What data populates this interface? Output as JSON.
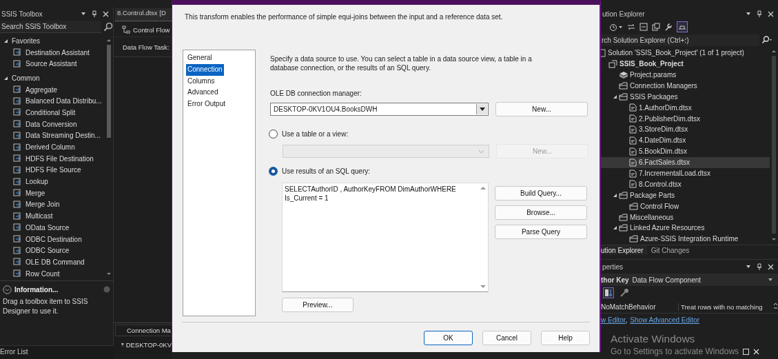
{
  "toolbox": {
    "title": "SSIS Toolbox",
    "search": {
      "placeholder": "Search SSIS Toolbox"
    },
    "groups": [
      {
        "label": "Favorites",
        "expanded": true,
        "children": [
          {
            "label": "Destination Assistant"
          },
          {
            "label": "Source Assistant"
          }
        ]
      },
      {
        "label": "Common",
        "expanded": true,
        "children": [
          {
            "label": "Aggregate"
          },
          {
            "label": "Balanced Data Distribu..."
          },
          {
            "label": "Conditional Split"
          },
          {
            "label": "Data Conversion"
          },
          {
            "label": "Data Streaming Destin..."
          },
          {
            "label": "Derived Column"
          },
          {
            "label": "HDFS File Destination"
          },
          {
            "label": "HDFS File Source"
          },
          {
            "label": "Lookup"
          },
          {
            "label": "Merge"
          },
          {
            "label": "Merge Join"
          },
          {
            "label": "Multicast"
          },
          {
            "label": "OData Source"
          },
          {
            "label": "ODBC Destination"
          },
          {
            "label": "ODBC Source"
          },
          {
            "label": "OLE DB Command"
          },
          {
            "label": "Row Count"
          }
        ]
      }
    ],
    "info": {
      "title": "Information...",
      "text": "Drag a toolbox item to SSIS Designer to use it."
    }
  },
  "error_list": {
    "title": "Error List"
  },
  "document": {
    "tab": "8.Control.dtsx [D",
    "designer_tab": "Control Flow",
    "task_label": "Data Flow Task:",
    "connection_managers": {
      "header": "Connection Ma",
      "items": [
        "DESKTOP-0KV"
      ]
    }
  },
  "dialog": {
    "description": "This transform enables the performance of simple equi-joins between the input and a reference data set.",
    "nav": [
      {
        "label": "General",
        "selected": false
      },
      {
        "label": "Connection",
        "selected": true
      },
      {
        "label": "Columns",
        "selected": false
      },
      {
        "label": "Advanced",
        "selected": false
      },
      {
        "label": "Error Output",
        "selected": false
      }
    ],
    "intro": "Specify a data source to use. You can select a table in a data source view, a table in a database connection, or the results of an SQL query.",
    "connection_label": "OLE DB connection manager:",
    "connection_value": "DESKTOP-0KV1OU4.BooksDWH",
    "connection_new_button": "New...",
    "sources": [
      {
        "label": "Use a table or a view:",
        "selected": false
      },
      {
        "label": "Use results of an SQL query:",
        "selected": true
      }
    ],
    "table_new_button": {
      "label": "New...",
      "disabled": true
    },
    "query": "SELECTAuthorID , AuthorKeyFROM DimAuthorWHERE\nIs_Current = 1",
    "query_buttons": [
      "Build Query...",
      "Browse...",
      "Parse Query"
    ],
    "preview_button": "Preview...",
    "footer_buttons": [
      "OK",
      "Cancel",
      "Help"
    ]
  },
  "solution_explorer": {
    "title": "ution Explorer",
    "search": {
      "placeholder": "rch Solution Explorer (Ctrl+؛)"
    },
    "tree": [
      {
        "label": "Solution 'SSIS_Book_Project' (1 of 1 project)",
        "kind": "solution",
        "selected": false,
        "children": [
          {
            "label": "SSIS_Book_Project",
            "kind": "project",
            "selected": false,
            "children": [
              {
                "label": "Project.params",
                "kind": "params",
                "selected": false
              },
              {
                "label": "Connection Managers",
                "kind": "folder",
                "selected": false
              },
              {
                "label": "SSIS Packages",
                "kind": "folder",
                "expanded": true,
                "selected": false,
                "children": [
                  {
                    "label": "1.AuthorDim.dtsx",
                    "kind": "package",
                    "selected": false
                  },
                  {
                    "label": "2.PublisherDim.dtsx",
                    "kind": "package",
                    "selected": false
                  },
                  {
                    "label": "3.StoreDim.dtsx",
                    "kind": "package",
                    "selected": false
                  },
                  {
                    "label": "4.DateDim.dtsx",
                    "kind": "package",
                    "selected": false
                  },
                  {
                    "label": "5.BookDim.dtsx",
                    "kind": "package",
                    "selected": false
                  },
                  {
                    "label": "6.FactSales.dtsx",
                    "kind": "package",
                    "selected": true
                  },
                  {
                    "label": "7.IncrementalLoad.dtsx",
                    "kind": "package",
                    "selected": false
                  },
                  {
                    "label": "8.Control.dtsx",
                    "kind": "package",
                    "selected": false
                  }
                ]
              },
              {
                "label": "Package Parts",
                "kind": "folder",
                "expanded": true,
                "selected": false,
                "children": [
                  {
                    "label": "Control Flow",
                    "kind": "folder",
                    "selected": false
                  }
                ]
              },
              {
                "label": "Miscellaneous",
                "kind": "folder",
                "selected": false
              },
              {
                "label": "Linked Azure Resources",
                "kind": "folder",
                "expanded": true,
                "selected": false,
                "children": [
                  {
                    "label": "Azure-SSIS Integration Runtime",
                    "kind": "folder",
                    "selected": false
                  }
                ]
              }
            ]
          }
        ]
      }
    ],
    "tabs": [
      {
        "label": "ution Explorer",
        "selected": true
      },
      {
        "label": "Git Changes",
        "selected": false
      }
    ]
  },
  "properties": {
    "title": "perties",
    "object_name": "thor Key",
    "object_type": "Data Flow Component",
    "rows": [
      {
        "name": "NoMatchBehavior",
        "value": "Treat rows with no matching"
      }
    ],
    "links": [
      "w Editor",
      "Show Advanced Editor"
    ],
    "link_separator": ","
  },
  "activation": {
    "title": "Activate Windows",
    "text": "Go to Settings to activate Windows"
  }
}
